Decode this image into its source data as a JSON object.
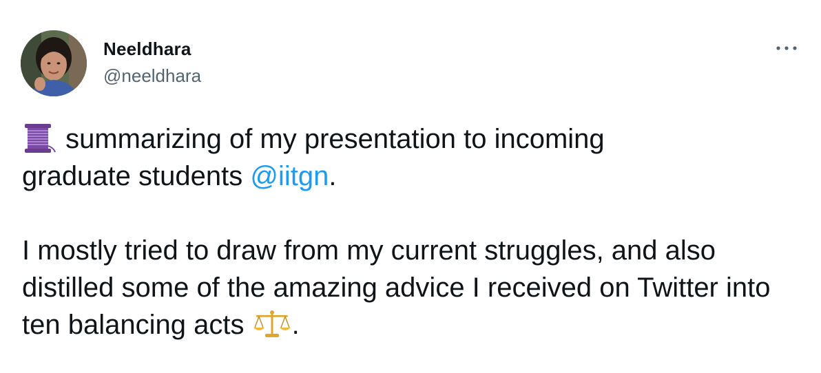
{
  "author": {
    "name": "Neeldhara",
    "handle": "@neeldhara"
  },
  "tweet": {
    "line1_after_thread_emoji": " summarizing of my presentation to incoming",
    "line2_before_mention": "graduate students ",
    "mention": "@iitgn",
    "line2_after_mention": ".",
    "paragraph2_text": "I mostly tried to draw from my current struggles, and also distilled some of the amazing advice I received on Twitter into ten balancing acts ",
    "paragraph2_end": "."
  },
  "icons": {
    "thread": "thread-spool-emoji",
    "balance": "balance-scale-emoji",
    "more": "more-dots-icon"
  },
  "colors": {
    "text": "#0f1419",
    "secondary": "#536471",
    "link": "#1d9bf0",
    "background": "#ffffff"
  }
}
